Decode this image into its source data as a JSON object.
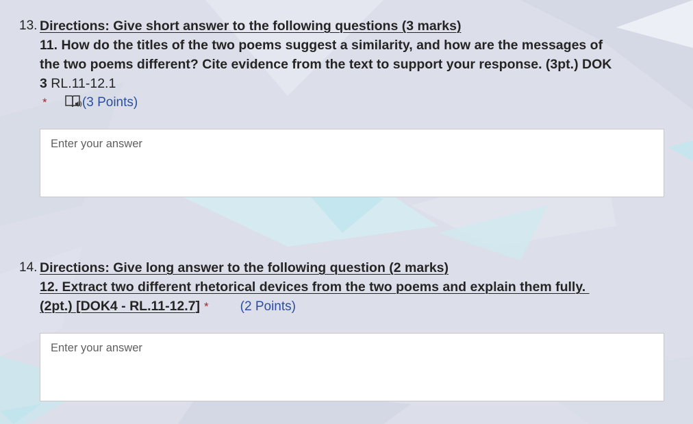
{
  "questions": [
    {
      "number": "13.",
      "directions": "Directions: Give short answer to the following questions (3 marks)",
      "prompt_line1": "11. How do the titles of the two poems suggest a similarity, and how are the messages of",
      "prompt_line2": "the two poems different? Cite evidence from the text to support your response. (3pt.) DOK",
      "prompt_line3_bold": "3",
      "prompt_line3_normal": " RL.11-12.1",
      "required_mark": "*",
      "immersive_reader_icon": "immersive-reader-icon",
      "points": "(3 Points)",
      "answer_placeholder": "Enter your answer"
    },
    {
      "number": "14.",
      "directions": "Directions: Give long answer to the following question (2 marks)",
      "prompt_line1": "12. Extract two different rhetorical devices from the two poems and explain them fully. ",
      "prompt_line2": "(2pt.) [DOK4 - RL.11-12.7]",
      "required_mark": "*",
      "points": "(2 Points)",
      "answer_placeholder": "Enter your answer"
    }
  ],
  "colors": {
    "text": "#242424",
    "required": "#a4262c",
    "points": "#2b4ea0",
    "background": "#dcdfe9",
    "input_border": "#c8c8c8",
    "placeholder": "#5f5f5f"
  }
}
